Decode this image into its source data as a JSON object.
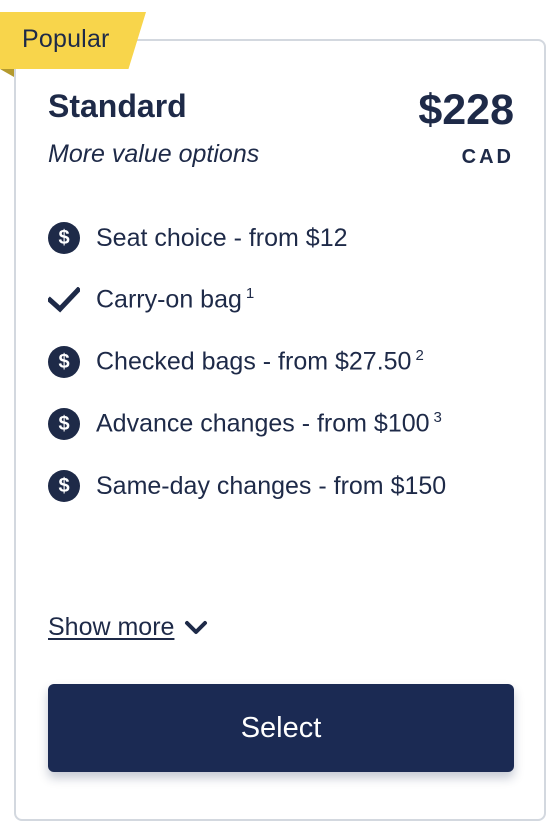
{
  "badge": {
    "label": "Popular"
  },
  "fare": {
    "name": "Standard",
    "tagline": "More value options",
    "price": "$228",
    "currency": "CAD"
  },
  "features": [
    {
      "icon": "dollar-circle-icon",
      "label": "Seat choice - from $12",
      "note": ""
    },
    {
      "icon": "checkmark-icon",
      "label": "Carry-on bag",
      "note": "1"
    },
    {
      "icon": "dollar-circle-icon",
      "label": "Checked bags - from $27.50",
      "note": "2"
    },
    {
      "icon": "dollar-circle-icon",
      "label": "Advance changes - from $100",
      "note": "3"
    },
    {
      "icon": "dollar-circle-icon",
      "label": "Same-day changes - from $150",
      "note": ""
    }
  ],
  "dollar_glyph": "$",
  "show_more": {
    "label": "Show more"
  },
  "select_button": {
    "label": "Select"
  },
  "colors": {
    "navy": "#1e2a48",
    "button": "#1b2a53",
    "badge": "#f8d54b",
    "border": "#d3d8df"
  }
}
